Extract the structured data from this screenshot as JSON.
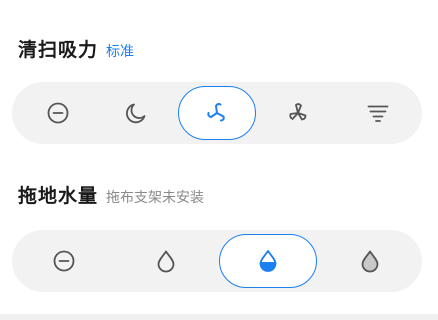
{
  "suction": {
    "title": "清扫吸力",
    "value": "标准",
    "options": [
      {
        "icon": "off-icon",
        "selected": false
      },
      {
        "icon": "quiet-moon-icon",
        "selected": false
      },
      {
        "icon": "standard-fan-icon",
        "selected": true
      },
      {
        "icon": "strong-fan-icon",
        "selected": false
      },
      {
        "icon": "max-tornado-icon",
        "selected": false
      }
    ]
  },
  "water": {
    "title": "拖地水量",
    "status": "拖布支架未安装",
    "options": [
      {
        "icon": "off-icon",
        "selected": false
      },
      {
        "icon": "low-water-drop-icon",
        "selected": false
      },
      {
        "icon": "medium-water-drop-icon",
        "selected": true
      },
      {
        "icon": "high-water-drop-icon",
        "selected": false
      }
    ]
  },
  "colors": {
    "accent": "#1e7ff0",
    "selector_bg": "#f2f2f2",
    "icon": "#555555",
    "disabled_text": "#8a8a8a"
  }
}
